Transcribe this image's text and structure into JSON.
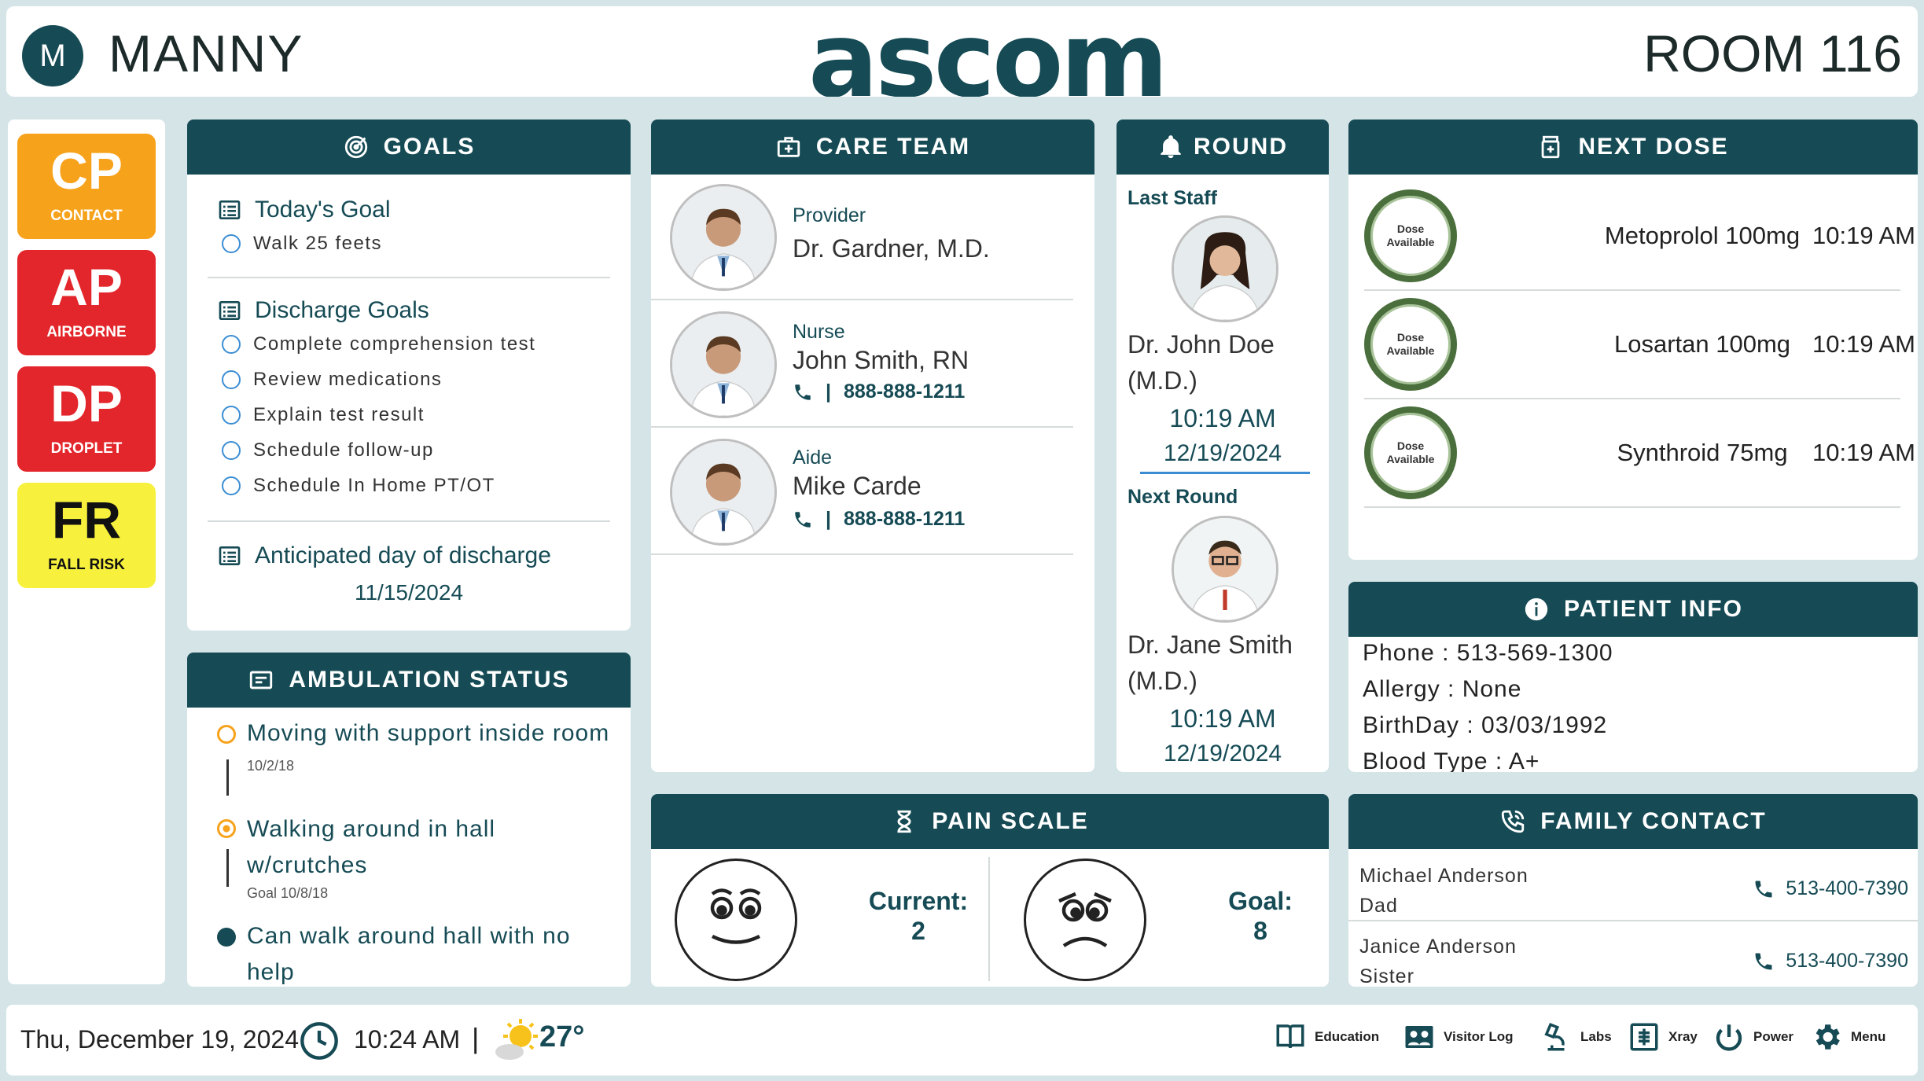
{
  "top": {
    "avatar_initial": "M",
    "patient_name": "MANNY",
    "logo": "ascom",
    "room": "ROOM 116"
  },
  "isolation": [
    {
      "code": "CP",
      "label": "CONTACT",
      "color": "#f7a21b",
      "text_color": "#ffffff"
    },
    {
      "code": "AP",
      "label": "AIRBORNE",
      "color": "#e3262b",
      "text_color": "#ffffff"
    },
    {
      "code": "DP",
      "label": "DROPLET",
      "color": "#e3262b",
      "text_color": "#ffffff"
    },
    {
      "code": "FR",
      "label": "FALL RISK",
      "color": "#f7f13e",
      "text_color": "#111111"
    }
  ],
  "goals": {
    "title": "GOALS",
    "today_title": "Today's Goal",
    "today_items": [
      "Walk 25 feets"
    ],
    "discharge_title": "Discharge Goals",
    "discharge_items": [
      "Complete comprehension test",
      "Review medications",
      "Explain test result",
      "Schedule follow-up",
      "Schedule In Home PT/OT"
    ],
    "anticipated_title": "Anticipated day of discharge",
    "anticipated_date": "11/15/2024"
  },
  "ambulation": {
    "title": "AMBULATION STATUS",
    "items": [
      {
        "text": "Moving with support inside room",
        "date": "10/2/18",
        "state": "open"
      },
      {
        "text": "Walking around in hall w/crutches",
        "date": "Goal 10/8/18",
        "state": "current"
      },
      {
        "text": "Can walk around hall with no help",
        "date": "",
        "state": "done"
      }
    ]
  },
  "care_team": {
    "title": "CARE TEAM",
    "members": [
      {
        "role": "Provider",
        "name": "Dr. Gardner, M.D.",
        "phone": ""
      },
      {
        "role": "Nurse",
        "name": "John Smith, RN",
        "phone": "888-888-1211"
      },
      {
        "role": "Aide",
        "name": "Mike Carde",
        "phone": "888-888-1211"
      }
    ]
  },
  "round": {
    "title": "ROUND",
    "last_label": "Last Staff",
    "last_name": "Dr. John Doe",
    "last_cred": "(M.D.)",
    "last_time": "10:19 AM",
    "last_date": "12/19/2024",
    "next_label": "Next Round",
    "next_name": "Dr. Jane Smith",
    "next_cred": "(M.D.)",
    "next_time": "10:19 AM",
    "next_date": "12/19/2024"
  },
  "next_dose": {
    "title": "NEXT DOSE",
    "badge": "Dose Available",
    "items": [
      {
        "med": "Metoprolol 100mg",
        "time": "10:19 AM"
      },
      {
        "med": "Losartan 100mg",
        "time": "10:19 AM"
      },
      {
        "med": "Synthroid 75mg",
        "time": "10:19 AM"
      }
    ]
  },
  "patient_info": {
    "title": "PATIENT INFO",
    "phone": "Phone : 513-569-1300",
    "allergy": "Allergy : None",
    "birthday": "BirthDay : 03/03/1992",
    "blood": "Blood Type : A+"
  },
  "pain": {
    "title": "PAIN SCALE",
    "current_label": "Current:",
    "current_value": "2",
    "goal_label": "Goal:",
    "goal_value": "8"
  },
  "family": {
    "title": "FAMILY CONTACT",
    "contacts": [
      {
        "name": "Michael Anderson",
        "relation": "Dad",
        "phone": "513-400-7390"
      },
      {
        "name": "Janice Anderson",
        "relation": "Sister",
        "phone": "513-400-7390"
      }
    ]
  },
  "bottom": {
    "date": "Thu, December 19, 2024",
    "time": "10:24 AM",
    "separator": "|",
    "temp": "27°",
    "buttons": [
      "Education",
      "Visitor Log",
      "Labs",
      "Xray",
      "Power",
      "Menu"
    ]
  },
  "colors": {
    "header": "#164b55",
    "background": "#d5e5e7",
    "accent_circle": "#3b8dd3",
    "ambulation_open": "#f7a21b"
  }
}
